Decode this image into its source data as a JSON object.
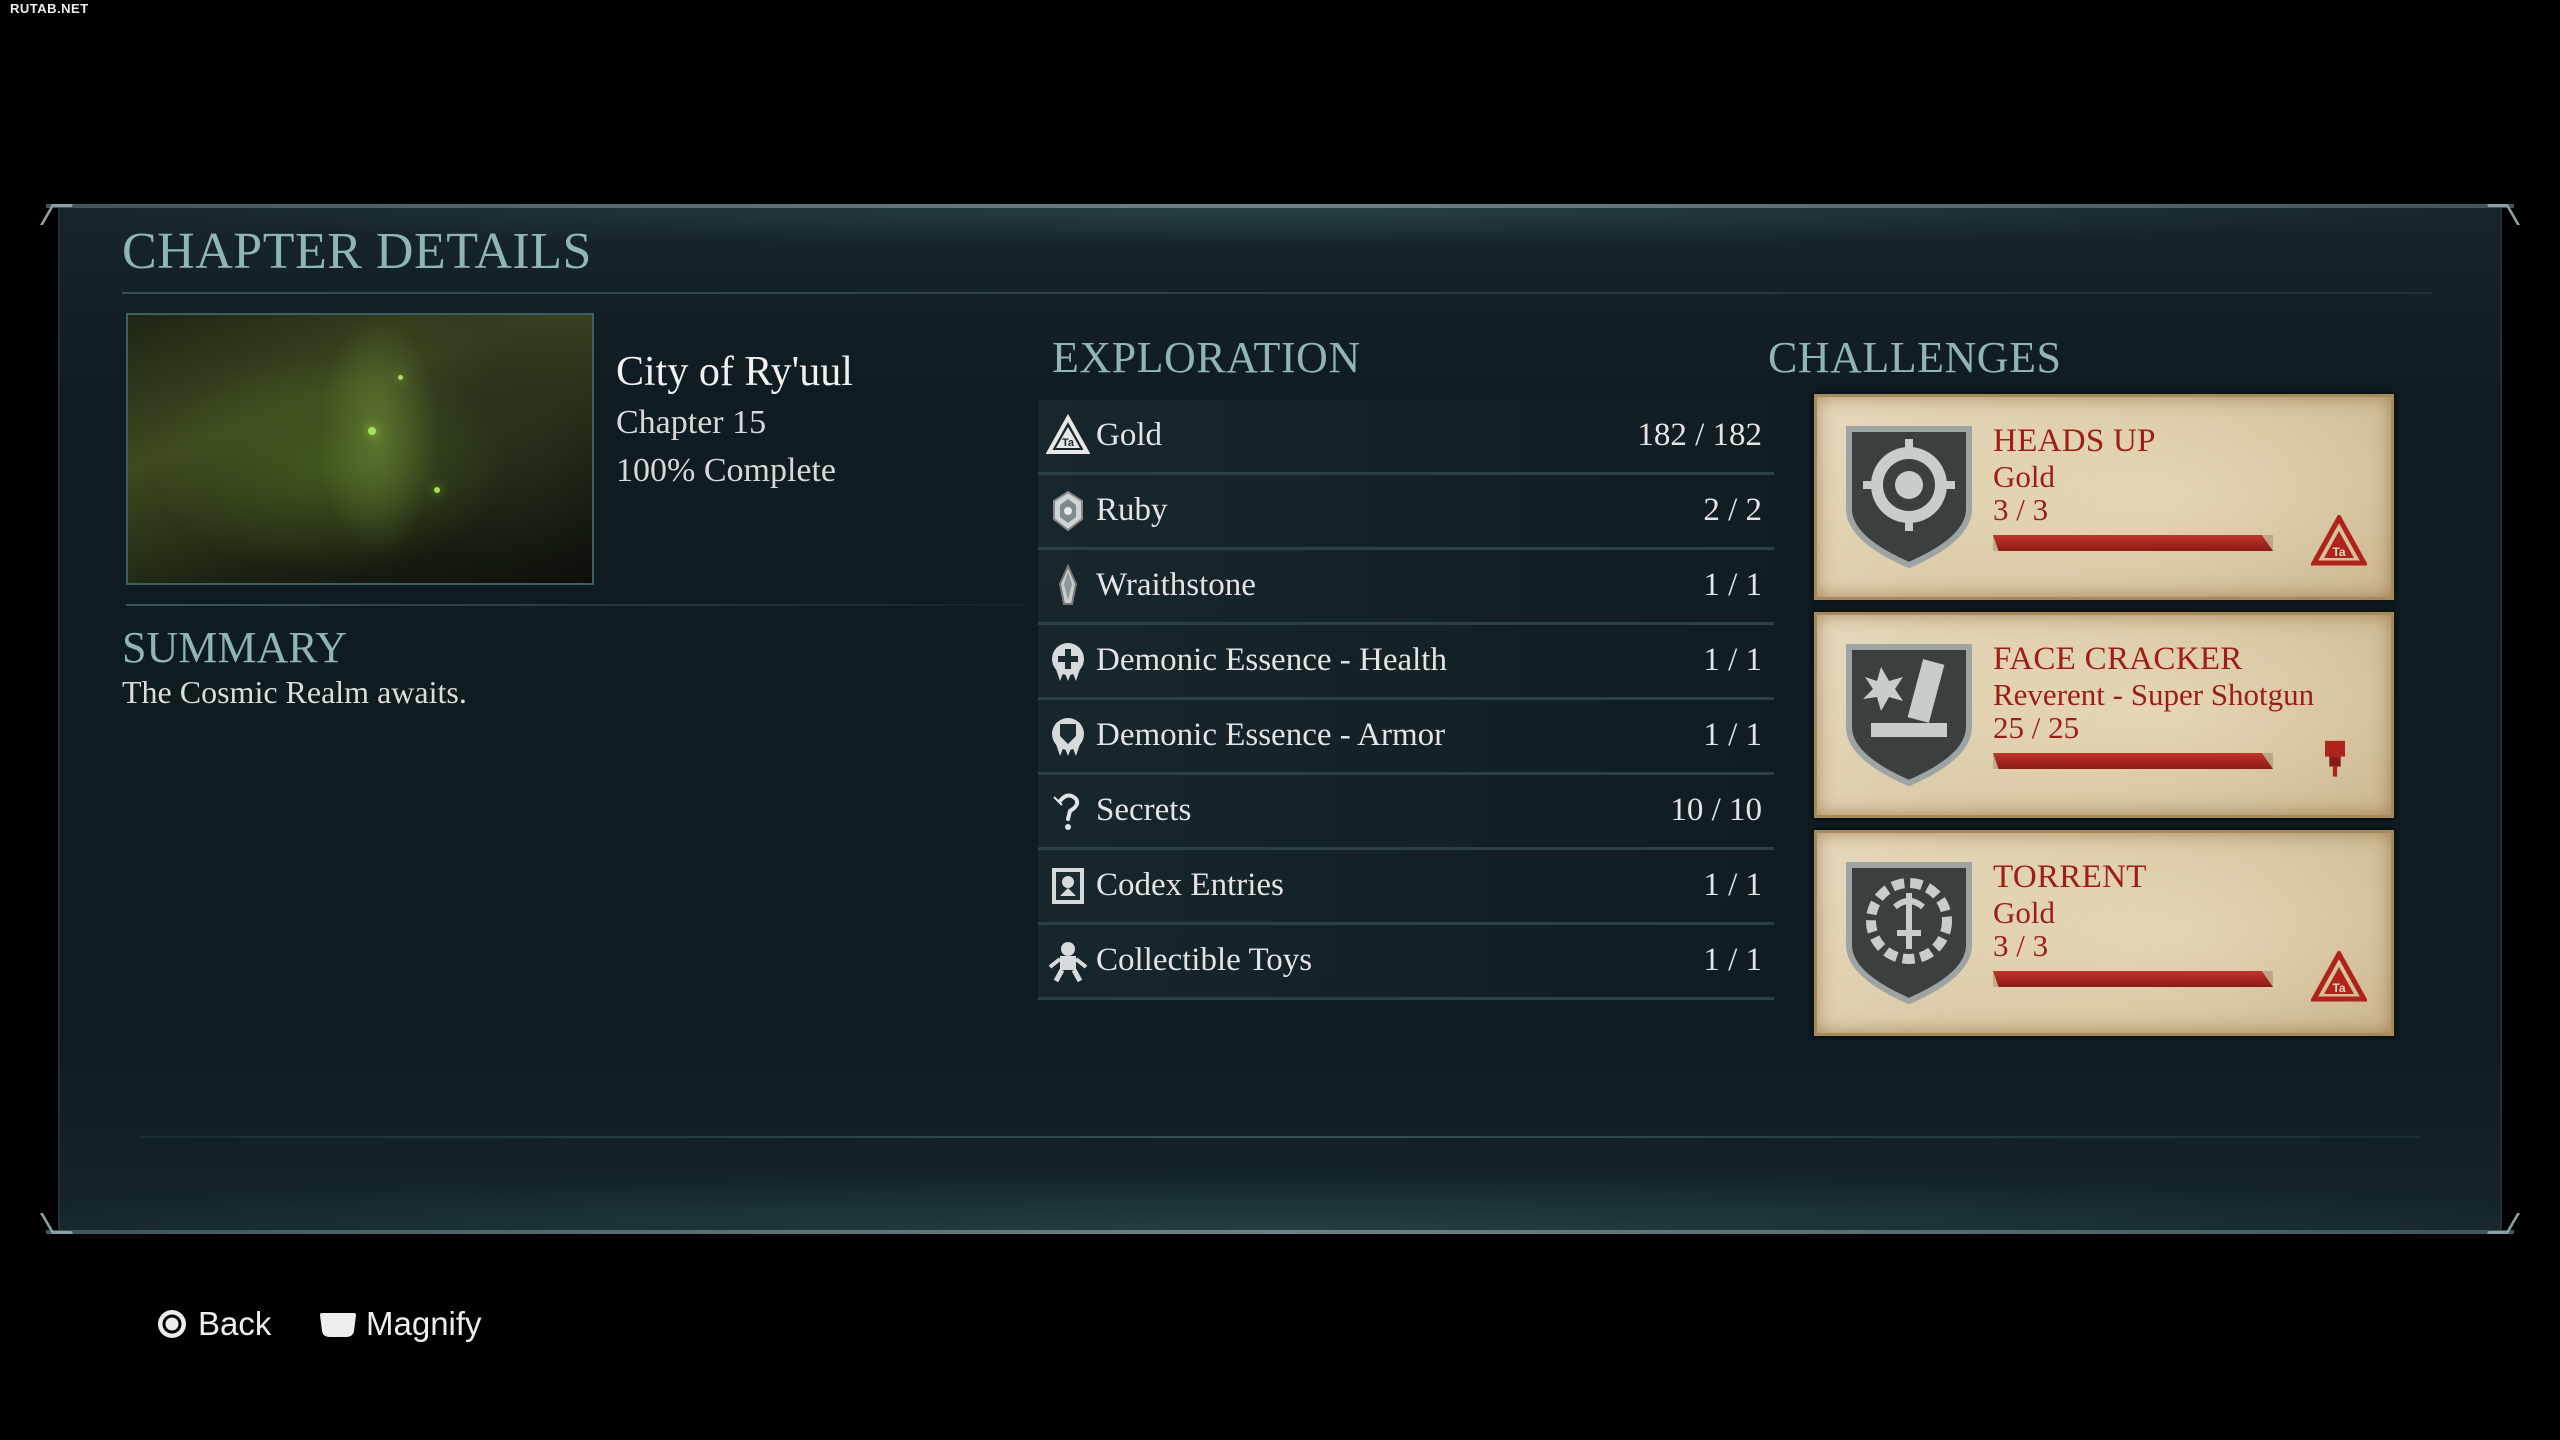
{
  "watermark": "RUTAB.NET",
  "panel": {
    "title": "CHAPTER DETAILS"
  },
  "chapter": {
    "name": "City of Ry'uul",
    "number": "Chapter 15",
    "completion": "100% Complete"
  },
  "summary": {
    "title": "SUMMARY",
    "text": "The Cosmic Realm awaits."
  },
  "exploration": {
    "title": "EXPLORATION",
    "items": [
      {
        "icon": "gold-triangle-icon",
        "label": "Gold",
        "count": "182 / 182"
      },
      {
        "icon": "ruby-icon",
        "label": "Ruby",
        "count": "2 / 2"
      },
      {
        "icon": "wraithstone-icon",
        "label": "Wraithstone",
        "count": "1 / 1"
      },
      {
        "icon": "health-essence-icon",
        "label": "Demonic Essence - Health",
        "count": "1 / 1"
      },
      {
        "icon": "armor-essence-icon",
        "label": "Demonic Essence - Armor",
        "count": "1 / 1"
      },
      {
        "icon": "secret-icon",
        "label": "Secrets",
        "count": "10 / 10"
      },
      {
        "icon": "codex-icon",
        "label": "Codex Entries",
        "count": "1 / 1"
      },
      {
        "icon": "toy-icon",
        "label": "Collectible Toys",
        "count": "1 / 1"
      }
    ]
  },
  "challenges": {
    "title": "CHALLENGES",
    "cards": [
      {
        "title": "HEADS UP",
        "reward": "Gold",
        "progress": "3 / 3",
        "progress_fraction": 1.0,
        "badge_icon": "gear-skull-badge-icon",
        "reward_icon": "gold-triangle-icon"
      },
      {
        "title": "FACE CRACKER",
        "reward": "Reverent - Super Shotgun",
        "progress": "25 / 25",
        "progress_fraction": 1.0,
        "badge_icon": "weapon-badge-icon",
        "reward_icon": "paint-brush-icon"
      },
      {
        "title": "TORRENT",
        "reward": "Gold",
        "progress": "3 / 3",
        "progress_fraction": 1.0,
        "badge_icon": "gear-sigil-badge-icon",
        "reward_icon": "gold-triangle-icon"
      }
    ]
  },
  "footer": {
    "back_label": "Back",
    "back_icon": "circle-button-icon",
    "magnify_label": "Magnify",
    "magnify_icon": "touchpad-button-icon"
  },
  "colors": {
    "accent_teal": "#8fb6b3",
    "challenge_red": "#a01c17",
    "parchment": "#ddcba6"
  }
}
